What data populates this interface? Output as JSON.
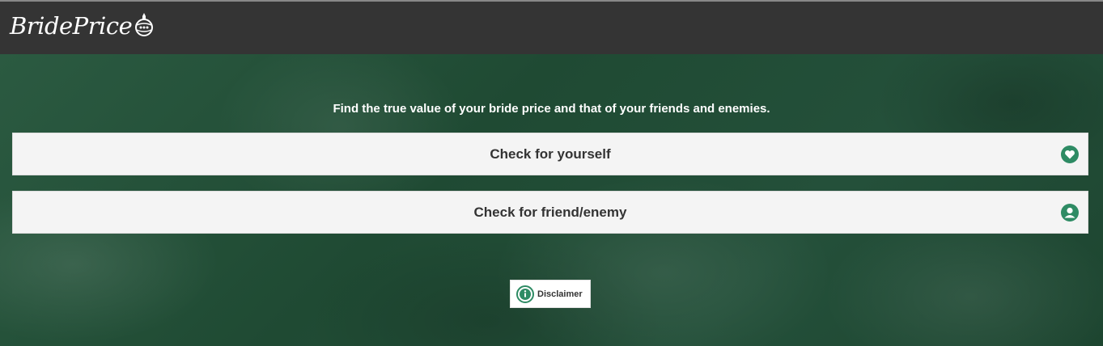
{
  "header": {
    "logo_text": "BridePrice",
    "logo_icon": "ornament-icon"
  },
  "hero": {
    "tagline": "Find the true value of your bride price and that of your friends and enemies."
  },
  "options": [
    {
      "label": "Check for yourself",
      "icon": "heart-icon"
    },
    {
      "label": "Check for friend/enemy",
      "icon": "user-icon"
    }
  ],
  "disclaimer": {
    "label": "Disclaimer",
    "icon": "info-icon"
  },
  "colors": {
    "accent": "#2e8b64",
    "header_bg": "#343434",
    "hero_bg": "#234d38"
  }
}
